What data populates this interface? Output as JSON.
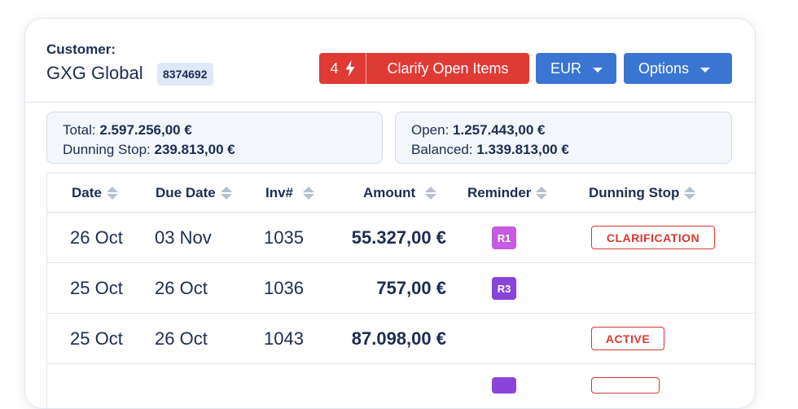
{
  "customer": {
    "label": "Customer:",
    "name": "GXG Global",
    "id": "8374692"
  },
  "actions": {
    "clarify_count": "4",
    "clarify_label": "Clarify Open Items",
    "currency": "EUR",
    "options_label": "Options"
  },
  "summary": {
    "total_label": "Total:",
    "total_value": "2.597.256,00 €",
    "dunning_stop_label": "Dunning Stop:",
    "dunning_stop_value": "239.813,00 €",
    "open_label": "Open:",
    "open_value": "1.257.443,00 €",
    "balanced_label": "Balanced:",
    "balanced_value": "1.339.813,00 €"
  },
  "table": {
    "columns": [
      "Date",
      "Due Date",
      "Inv#",
      "Amount",
      "Reminder",
      "Dunning Stop"
    ],
    "rows": [
      {
        "date": "26 Oct",
        "due": "03 Nov",
        "inv": "1035",
        "amount": "55.327,00 €",
        "reminder": "R1",
        "stop": "CLARIFICATION"
      },
      {
        "date": "25 Oct",
        "due": "26 Oct",
        "inv": "1036",
        "amount": "757,00 €",
        "reminder": "R3",
        "stop": ""
      },
      {
        "date": "25 Oct",
        "due": "26 Oct",
        "inv": "1043",
        "amount": "87.098,00 €",
        "reminder": "",
        "stop": "ACTIVE"
      }
    ]
  },
  "colors": {
    "accent_blue": "#3a75d1",
    "clarify_red": "#e03a35",
    "r1_badge": "#c45be0",
    "r3_badge": "#8a44d9",
    "stop_red": "#d8382f"
  },
  "icons": {
    "clarify": "lightning-bolt-icon",
    "sort": "sort-arrows-icon",
    "dropdown": "chevron-down-icon"
  }
}
